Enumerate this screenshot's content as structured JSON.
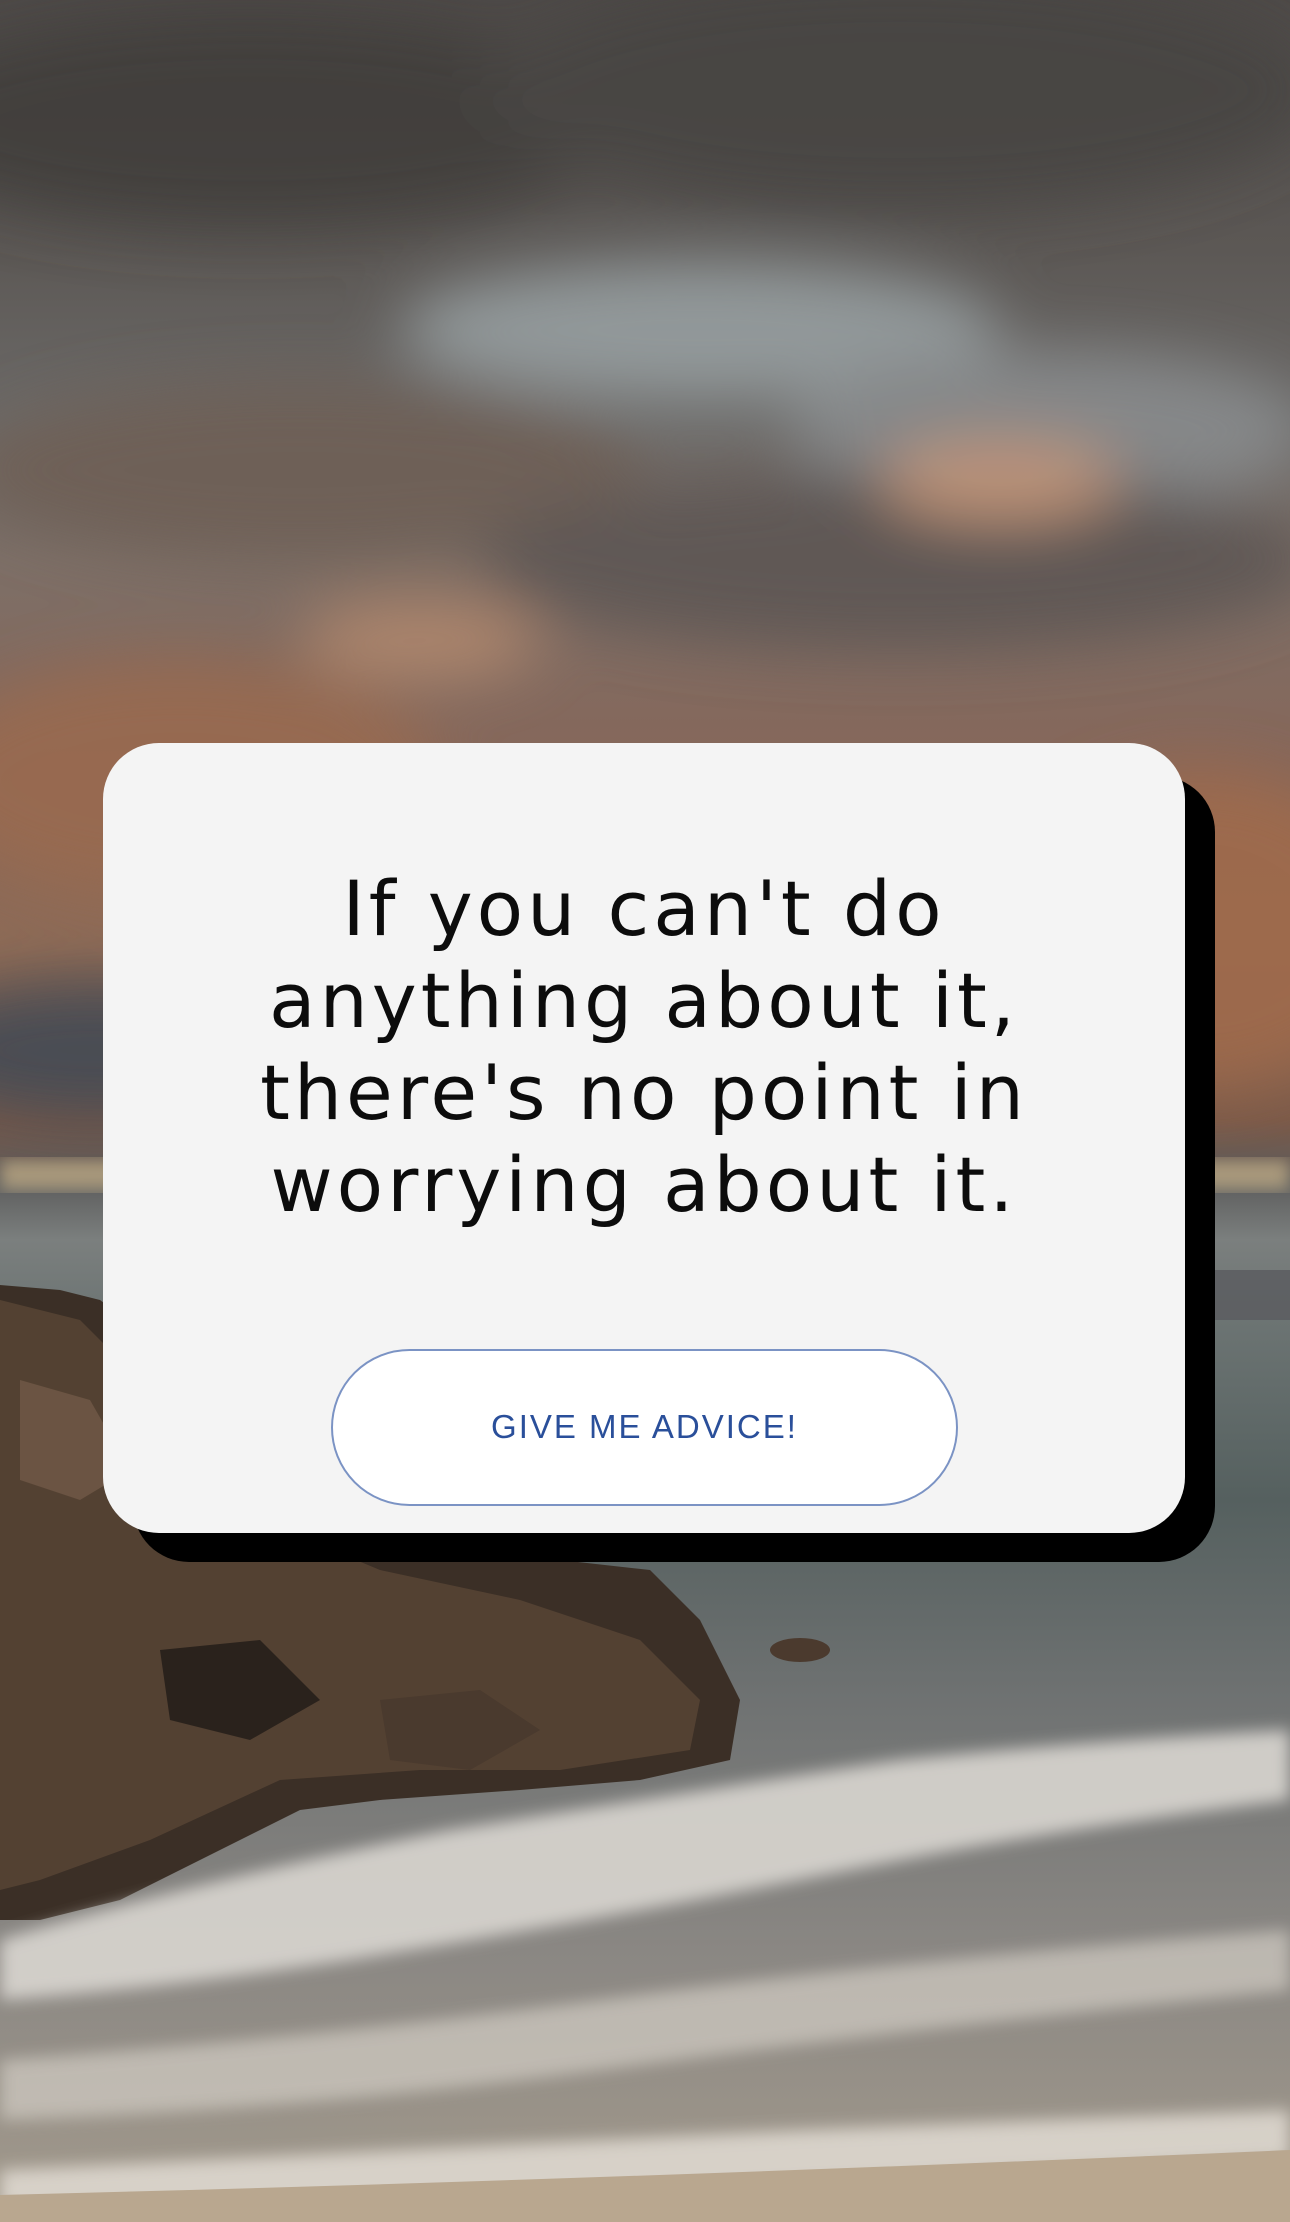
{
  "quote": {
    "text": "If you can't do anything about it, there's no point in worrying about it."
  },
  "button": {
    "label": "GIVE ME ADVICE!"
  },
  "colors": {
    "card_background": "#f4f4f4",
    "card_shadow": "#000000",
    "button_text": "#2a4f9a",
    "button_border": "#7b93c4"
  },
  "background": {
    "scene": "cloudy-sunset-beach-photo"
  }
}
